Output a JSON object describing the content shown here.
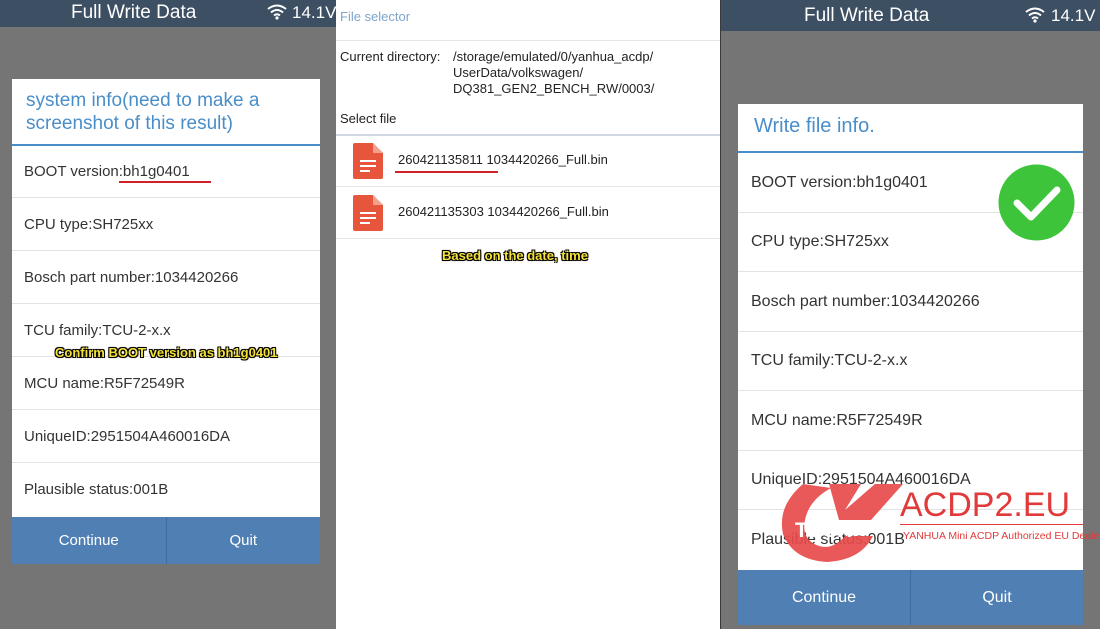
{
  "left_panel": {
    "status_title": "Full Write Data",
    "voltage": "14.1V",
    "dialog_title": "system info(need to make a screenshot of this result)",
    "rows": [
      {
        "label": "BOOT version:bh1g0401"
      },
      {
        "label": "CPU type:SH725xx"
      },
      {
        "label": "Bosch part number:1034420266"
      },
      {
        "label": "TCU family:TCU-2-x.x"
      },
      {
        "label": "MCU name:R5F72549R"
      },
      {
        "label": "UniqueID:2951504A460016DA"
      },
      {
        "label": "Plausible status:001B"
      }
    ],
    "caption": "Confirm BOOT version as bh1g0401",
    "continue_label": "Continue",
    "quit_label": "Quit"
  },
  "middle_panel": {
    "title": "File selector",
    "dir_label": "Current directory:",
    "dir_path_1": "/storage/emulated/0/yanhua_acdp/",
    "dir_path_2": "UserData/volkswagen/",
    "dir_path_3": "DQ381_GEN2_BENCH_RW/0003/",
    "select_label": "Select file",
    "files": [
      {
        "name": "260421135811 1034420266_Full.bin"
      },
      {
        "name": "260421135303 1034420266_Full.bin"
      }
    ],
    "caption": "Based on the date, time"
  },
  "right_panel": {
    "status_title": "Full Write Data",
    "voltage": "14.1V",
    "dialog_title": "Write file info.",
    "rows": [
      {
        "label": "BOOT version:bh1g0401"
      },
      {
        "label": "CPU type:SH725xx"
      },
      {
        "label": "Bosch part number:1034420266"
      },
      {
        "label": "TCU family:TCU-2-x.x"
      },
      {
        "label": "MCU name:R5F72549R"
      },
      {
        "label": "UniqueID:2951504A460016DA"
      },
      {
        "label": "Plausible status:001B"
      }
    ],
    "continue_label": "Continue",
    "quit_label": "Quit"
  },
  "watermark": {
    "logo_text": "TECH",
    "brand": "ACDP2.EU",
    "subtitle": "YANHUA Mini ACDP Authorized EU Dealer"
  },
  "colors": {
    "status_bar": "#3d4f62",
    "accent_blue": "#4a8ec9",
    "button_bar": "#4f7fb3",
    "file_icon": "#e8553d",
    "success_green": "#3ec43a",
    "underline_red": "#d0202a",
    "caption_yellow": "#f5e23a"
  },
  "icons": {
    "wifi": "wifi-icon",
    "file": "file-icon",
    "success": "check-circle-icon"
  }
}
